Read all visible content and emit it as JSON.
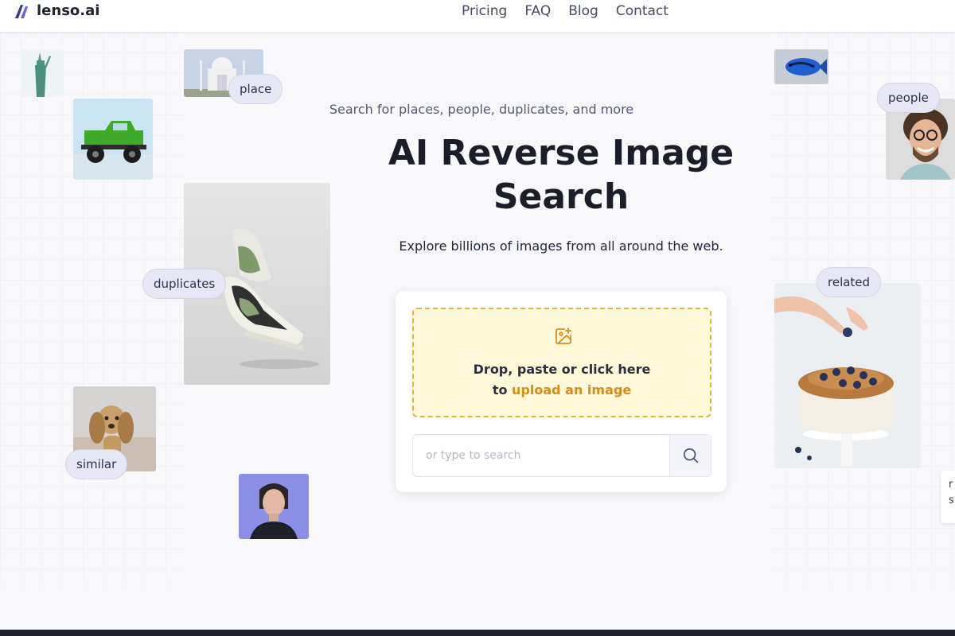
{
  "brand": {
    "name": "lenso.ai",
    "accent": "#5b4fe0"
  },
  "nav": {
    "items": [
      "Pricing",
      "FAQ",
      "Blog",
      "Contact"
    ]
  },
  "hero": {
    "subtitle": "Search for places, people, duplicates, and more",
    "title": "AI Reverse Image Search",
    "description": "Explore billions of images from all around the web."
  },
  "upload": {
    "icon": "image-add-icon",
    "line1": "Drop, paste or click here",
    "line2_prefix": "to",
    "line2_link": "upload an image",
    "accent_color": "#d88c1a"
  },
  "search": {
    "placeholder": "or type to search",
    "icon": "search-icon"
  },
  "chips": {
    "place": "place",
    "people": "people",
    "duplicates": "duplicates",
    "related": "related",
    "similar": "similar"
  },
  "edge_card": {
    "line1": "r",
    "line2": "s"
  }
}
